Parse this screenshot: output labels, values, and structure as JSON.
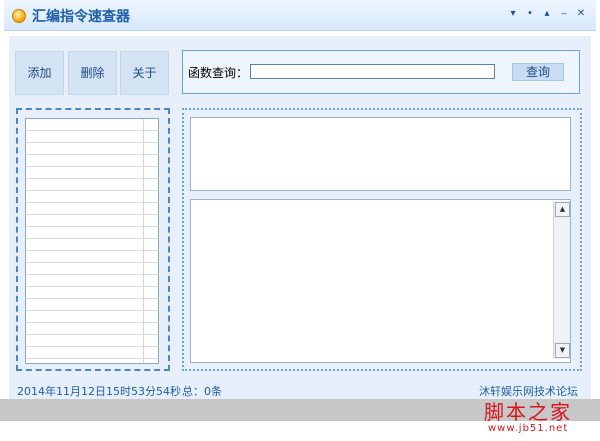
{
  "window": {
    "title": "汇编指令速查器",
    "controls": {
      "restore": "▾",
      "pin": "•",
      "up": "▴",
      "minimize": "_",
      "close": "✕"
    }
  },
  "toolbar": {
    "add_label": "添加",
    "delete_label": "删除",
    "about_label": "关于"
  },
  "query": {
    "label": "函数查询：",
    "input_value": "",
    "input_placeholder": "",
    "button_label": "查询"
  },
  "list": {
    "rows": [
      "",
      "",
      "",
      "",
      "",
      "",
      "",
      "",
      "",
      "",
      "",
      "",
      "",
      "",
      "",
      "",
      "",
      "",
      "",
      "",
      "",
      ""
    ]
  },
  "status": {
    "timestamp": "2014年11月12日15时53分54秒",
    "total": "总：0条",
    "forum": "沐轩娱乐网技术论坛"
  },
  "watermark": {
    "text": "脚本之家",
    "url": "www.jb51.net"
  },
  "colors": {
    "accent": "#1e5fa8",
    "panel": "#e7f0fa",
    "border": "#6fa2dd",
    "watermark": "#d9151b"
  },
  "icons": {
    "app": "app-icon",
    "scroll_up": "scroll-up-arrow-icon",
    "scroll_down": "scroll-down-arrow-icon"
  }
}
